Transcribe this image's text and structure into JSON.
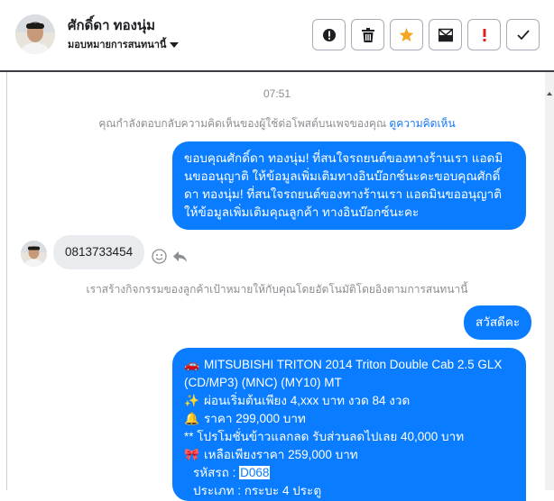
{
  "header": {
    "user_name": "ศักดิ์ดา ทองนุ่ม",
    "assignee_label": "มอบหมายการสนทนานี้",
    "actions": [
      {
        "name": "mark-spam",
        "icon": "exclamation-circle-icon"
      },
      {
        "name": "delete",
        "icon": "trash-icon"
      },
      {
        "name": "star",
        "icon": "star-icon"
      },
      {
        "name": "mark-unread",
        "icon": "envelope-icon"
      },
      {
        "name": "follow-up",
        "icon": "exclamation-icon"
      },
      {
        "name": "done",
        "icon": "check-icon"
      }
    ]
  },
  "chat": {
    "timestamp": "07:51",
    "notice_reply": "คุณกำลังตอบกลับความคิดเห็นของผู้ใช้ต่อโพสต์บนเพจของคุณ",
    "notice_reply_link": "ดูความคิดเห็น",
    "message_out_1": "ขอบคุณศักดิ์ดา ทองนุ่ม! ที่สนใจรถยนต์ของทางร้านเรา แอดมินขออนุญาติ ให้ข้อมูลเพิ่มเติมทางอินบ๊อกซ์นะคะขอบคุณศักดิ์ดา ทองนุ่ม! ที่สนใจรถยนต์ของทางร้านเรา แอดมินขออนุญาติ ให้ข้อมูลเพิ่มเติมคุณลูกค้า ทางอินบ๊อกซ์นะคะ",
    "message_in_1": "0813733454",
    "notice_activity": "เราสร้างกิจกรรมของลูกค้าเป้าหมายให้กับคุณโดยอัตโนมัติโดยอิงตามการสนทนานี้",
    "message_out_2": "สวัสดีคะ",
    "listing": {
      "title": "MITSUBISHI TRITON 2014 Triton Double Cab 2.5 GLX (CD/MP3) (MNC) (MY10) MT",
      "line_installment": "ผ่อนเริ่มต้นเพียง 4,xxx บาท งวด 84 งวด",
      "line_price": "ราคา 299,000 บาท",
      "line_promo": "** โปรโมชั่นข้าวแลกลด รับส่วนลดไปเลย 40,000 บาท",
      "line_final": "เหลือเพียงราคา 259,000 บาท",
      "line_code_label": "รหัสรถ :",
      "line_code_value": "D068",
      "line_type": "ประเภท : กระบะ 4 ประตู"
    }
  },
  "colors": {
    "bubble_out": "#0a7cff",
    "bubble_in": "#e9ebee",
    "link": "#1877f2",
    "star": "#f5a623",
    "follow_up": "#e02020"
  }
}
